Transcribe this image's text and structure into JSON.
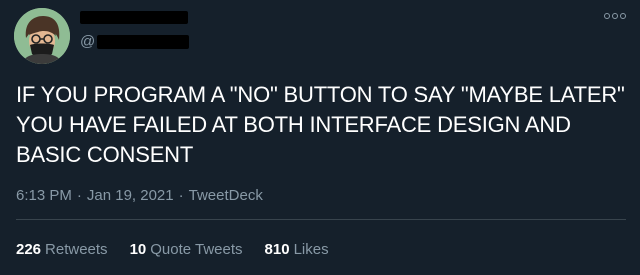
{
  "tweet": {
    "handle_prefix": "@",
    "text": "IF YOU PROGRAM A \"NO\" BUTTON TO SAY \"MAYBE LATER\" YOU HAVE FAILED AT BOTH INTERFACE DESIGN AND BASIC CONSENT",
    "time": "6:13 PM",
    "date": "Jan 19, 2021",
    "separator": "·",
    "source": "TweetDeck"
  },
  "stats": {
    "retweets_count": "226",
    "retweets_label": "Retweets",
    "quote_count": "10",
    "quote_label": "Quote Tweets",
    "likes_count": "810",
    "likes_label": "Likes"
  },
  "icons": {
    "more": "more-options-icon",
    "avatar": "avatar"
  },
  "colors": {
    "background": "#15202b",
    "secondary_text": "#8899a6",
    "divider": "#38444d",
    "avatar_bg": "#8fbc94"
  }
}
